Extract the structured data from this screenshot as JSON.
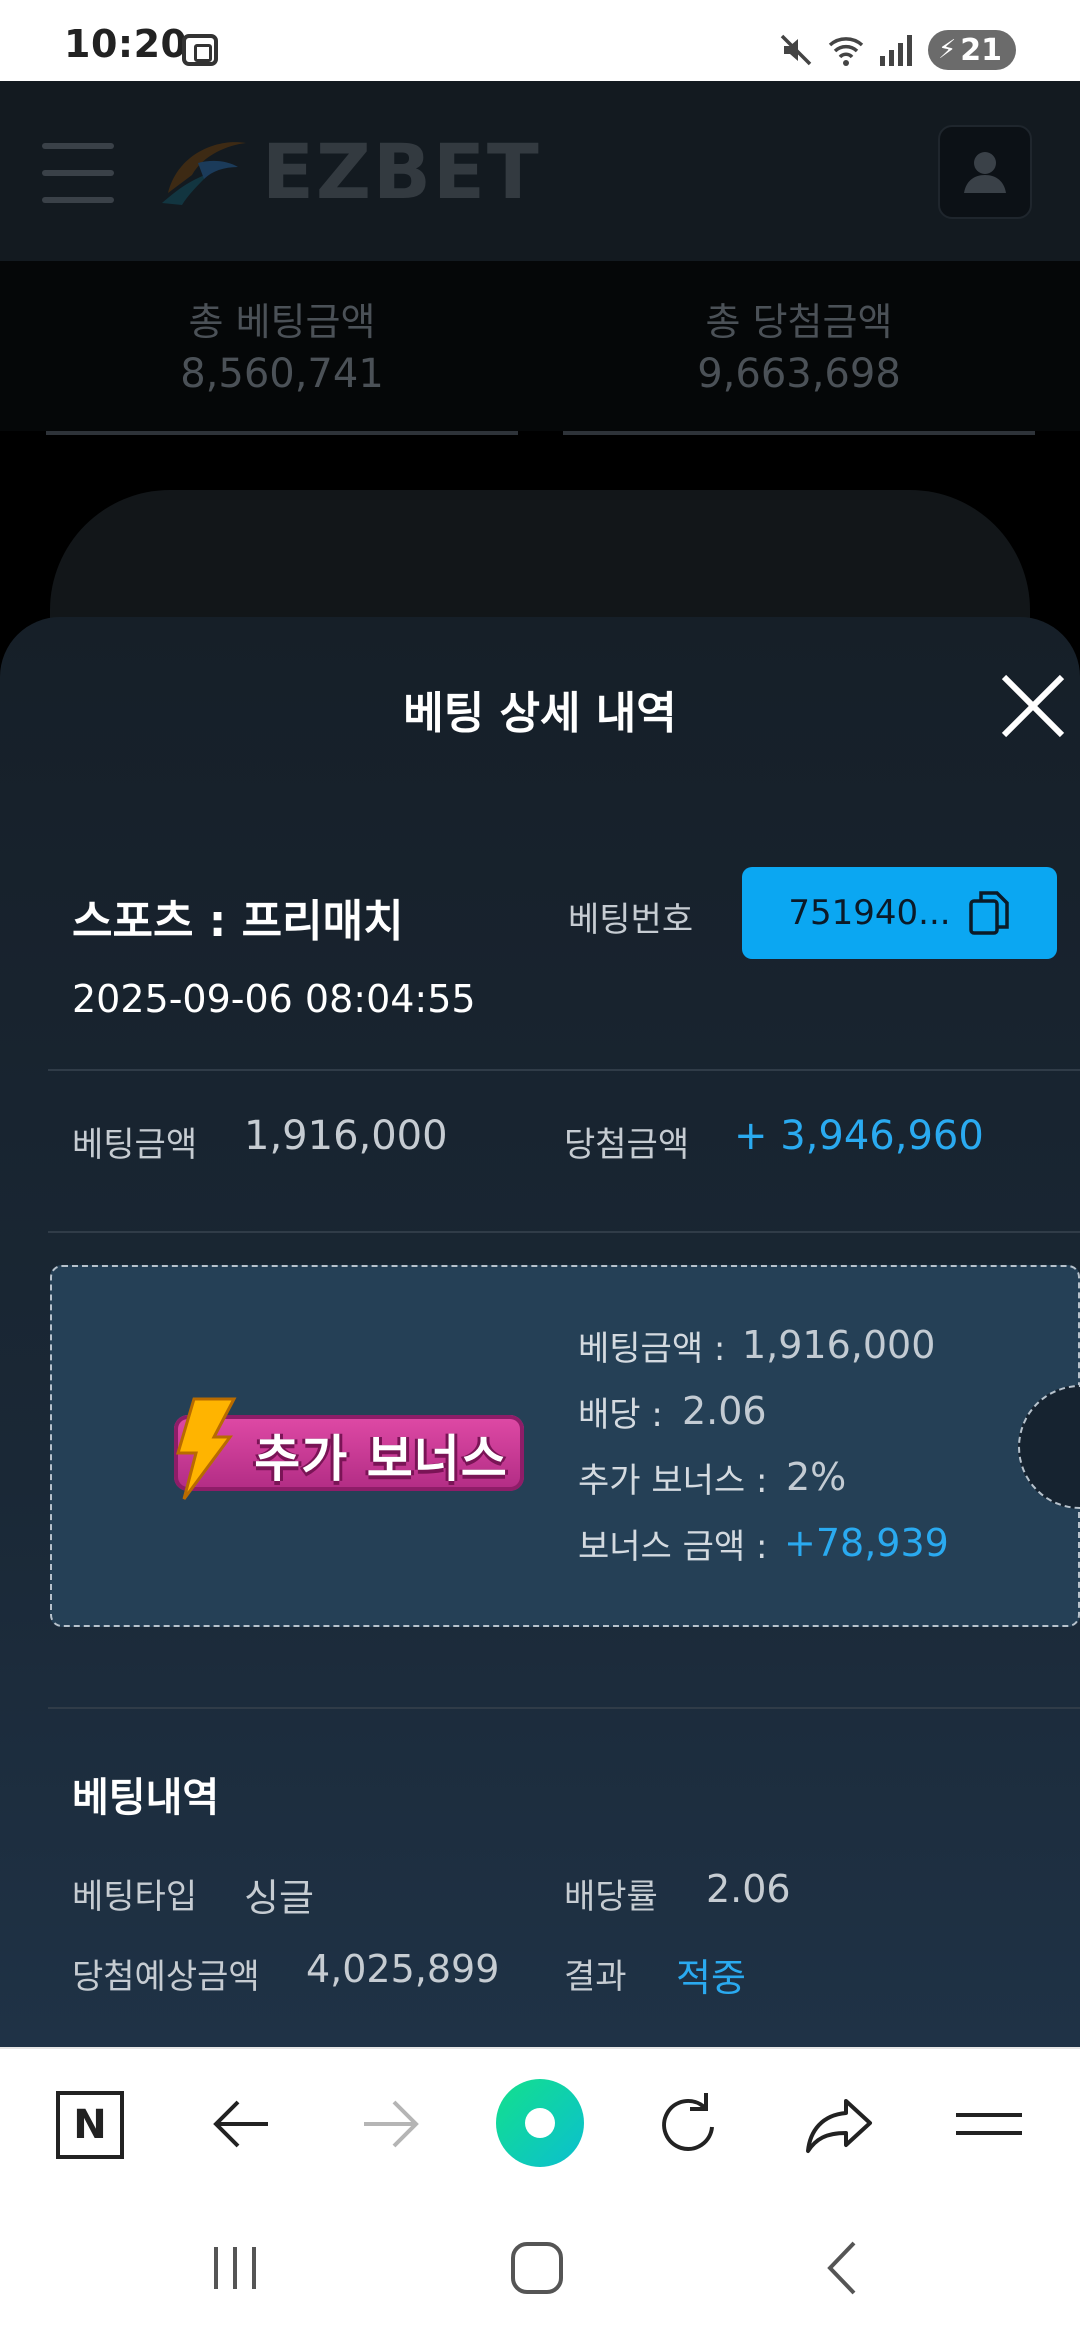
{
  "status_bar": {
    "time": "10:20",
    "battery": "21"
  },
  "header": {
    "logo_text": "EZBET"
  },
  "totals": {
    "bet_label": "총 베팅금액",
    "bet_value": "8,560,741",
    "win_label": "총 당첨금액",
    "win_value": "9,663,698"
  },
  "sheet": {
    "title": "베팅 상세 내역",
    "sport": "스포츠 : 프리매치",
    "datetime": "2025-09-06 08:04:55",
    "bet_no_label": "베팅번호",
    "bet_no_value": "751940...",
    "bet_amount_label": "베팅금액",
    "bet_amount_value": "1,916,000",
    "win_amount_label": "당첨금액",
    "win_amount_value": "+ 3,946,960",
    "bonus": {
      "badge_text": "추가 보너스",
      "bet_amount_label": "베팅금액 :",
      "bet_amount_value": "1,916,000",
      "odds_label": "배당 :",
      "odds_value": "2.06",
      "extra_label": "추가 보너스 :",
      "extra_value": "2%",
      "bonus_amount_label": "보너스 금액 :",
      "bonus_amount_value": "+78,939"
    },
    "history": {
      "title": "베팅내역",
      "type_label": "베팅타입",
      "type_value": "싱글",
      "odds_label": "배당률",
      "odds_value": "2.06",
      "expected_label": "당첨예상금액",
      "expected_value": "4,025,899",
      "result_label": "결과",
      "result_value": "적중"
    }
  },
  "browser_bar": {
    "n_label": "N"
  },
  "colors": {
    "accent": "#0ba7f2",
    "win_blue": "#2aaaf0",
    "sheet_bg": "#1a2836"
  }
}
